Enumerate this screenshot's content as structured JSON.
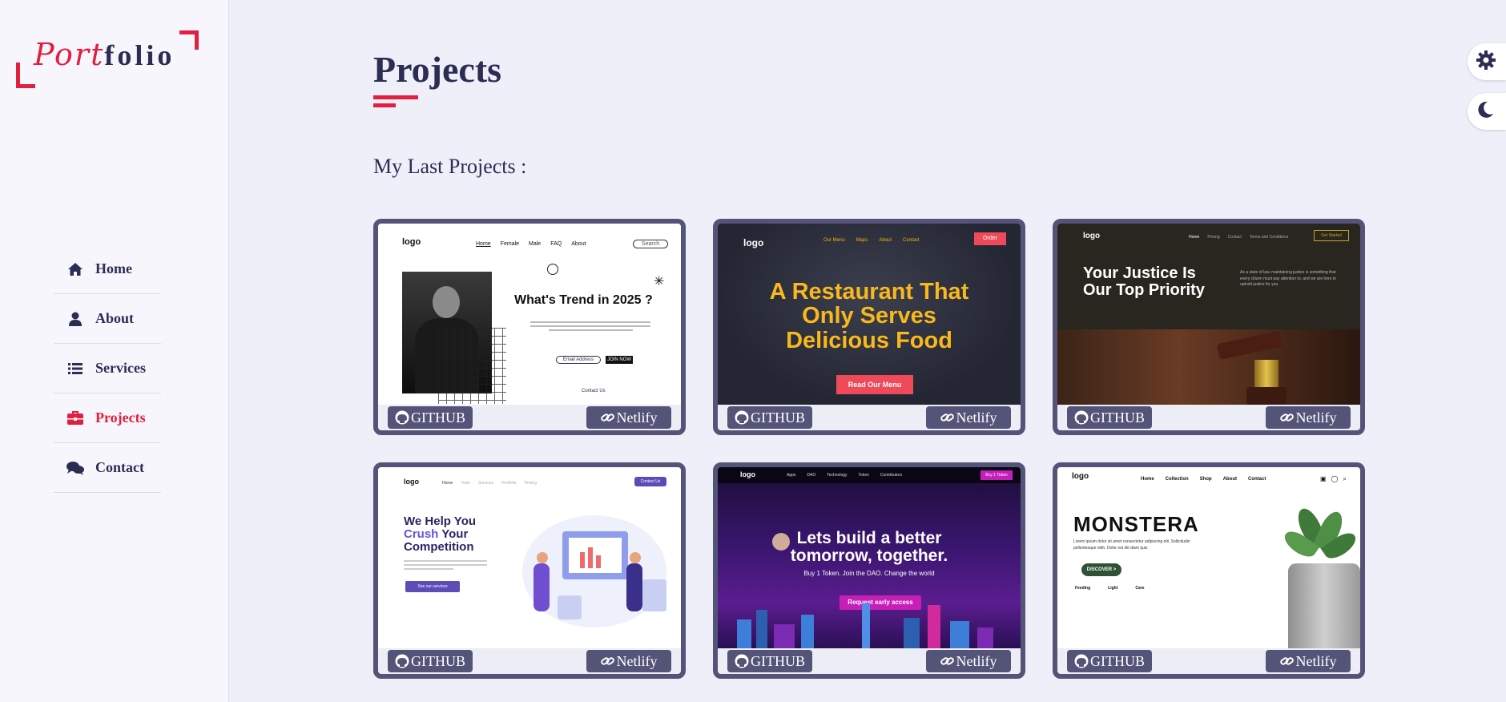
{
  "brand": {
    "logo_part1": "Port",
    "logo_part2": "folio"
  },
  "sidebar": {
    "items": [
      {
        "label": "Home",
        "icon": "home-icon"
      },
      {
        "label": "About",
        "icon": "user-icon"
      },
      {
        "label": "Services",
        "icon": "list-icon"
      },
      {
        "label": "Projects",
        "icon": "briefcase-icon",
        "active": true
      },
      {
        "label": "Contact",
        "icon": "comments-icon"
      }
    ]
  },
  "page": {
    "title": "Projects",
    "subtitle": "My Last Projects :"
  },
  "buttons": {
    "github_label": "GITHUB",
    "netlify_label": "Netlify"
  },
  "projects": [
    {
      "logo": "logo",
      "nav": [
        "Home",
        "Female",
        "Male",
        "FAQ",
        "About"
      ],
      "search": "Search",
      "headline": "What's Trend in 2025 ?",
      "email": "Email Address",
      "cta": "JOIN NOW",
      "footer": "Contact Us"
    },
    {
      "logo": "logo",
      "nav": [
        "Our Menu",
        "Maps",
        "About",
        "Contact"
      ],
      "order": "Order",
      "headline_1": "A Restaurant That",
      "headline_2": "Only Serves",
      "headline_3": "Delicious Food",
      "cta": "Read Our Menu"
    },
    {
      "logo": "logo",
      "nav": [
        "Home",
        "Pricing",
        "Contact",
        "Terms and Conditions"
      ],
      "cta": "Get Started",
      "headline_1": "Your Justice Is",
      "headline_2": "Our Top Priority",
      "body": "As a state of law, maintaining justice is something that every citizen must pay attention to, and we are here to uphold justice for you"
    },
    {
      "logo": "logo",
      "nav": [
        "Home",
        "Tools",
        "Services",
        "Portfolio",
        "Pricing"
      ],
      "contact": "Contact Us",
      "headline_1": "We Help You",
      "headline_2a": "Crush",
      "headline_2b": " Your",
      "headline_3": "Competition",
      "cta": "See our services"
    },
    {
      "logo": "logo",
      "nav": [
        "Apps",
        "DAO",
        "Technology",
        "Token",
        "Contributors"
      ],
      "buy": "Buy 1 Token",
      "headline_1": "Lets build a better",
      "headline_2": "tomorrow, together.",
      "sub": "Buy 1 Token. Join the DAO. Change the world",
      "cta": "Request early access"
    },
    {
      "logo": "logo",
      "nav": [
        "Home",
        "Collection",
        "Shop",
        "About",
        "Contact"
      ],
      "headline": "MONSTERA",
      "body": "Lorem ipsum dolor sit amet consectetur adipiscing elit. Sollicitudin pellentesque nibh. Dolor est elit diam quis",
      "cta": "DISCOVER >",
      "features": [
        "Feeding",
        "Light",
        "Care"
      ]
    }
  ],
  "colors": {
    "accent": "#e0203e",
    "navy": "#2b2d52",
    "card_border": "#545478",
    "background": "#eeeff8"
  }
}
